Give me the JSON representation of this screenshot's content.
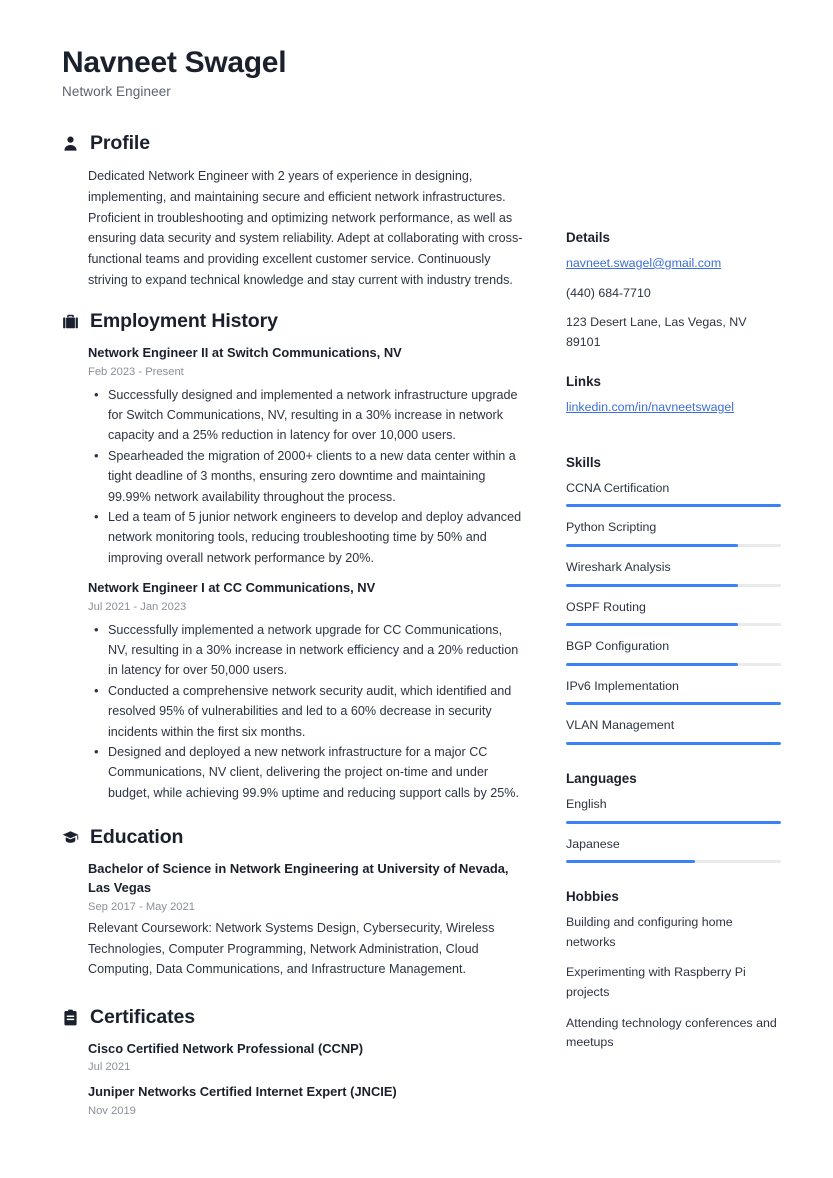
{
  "header": {
    "name": "Navneet Swagel",
    "job_title": "Network Engineer"
  },
  "accent_color": "#3b82f6",
  "link_color": "#3b6fd4",
  "profile": {
    "icon": "person-icon",
    "title": "Profile",
    "text": "Dedicated Network Engineer with 2 years of experience in designing, implementing, and maintaining secure and efficient network infrastructures. Proficient in troubleshooting and optimizing network performance, as well as ensuring data security and system reliability. Adept at collaborating with cross-functional teams and providing excellent customer service. Continuously striving to expand technical knowledge and stay current with industry trends."
  },
  "employment": {
    "icon": "briefcase-icon",
    "title": "Employment History",
    "entries": [
      {
        "title": "Network Engineer II at Switch Communications, NV",
        "date": "Feb 2023 - Present",
        "bullets": [
          "Successfully designed and implemented a network infrastructure upgrade for Switch Communications, NV, resulting in a 30% increase in network capacity and a 25% reduction in latency for over 10,000 users.",
          "Spearheaded the migration of 2000+ clients to a new data center within a tight deadline of 3 months, ensuring zero downtime and maintaining 99.99% network availability throughout the process.",
          "Led a team of 5 junior network engineers to develop and deploy advanced network monitoring tools, reducing troubleshooting time by 50% and improving overall network performance by 20%."
        ]
      },
      {
        "title": "Network Engineer I at CC Communications, NV",
        "date": "Jul 2021 - Jan 2023",
        "bullets": [
          "Successfully implemented a network upgrade for CC Communications, NV, resulting in a 30% increase in network efficiency and a 20% reduction in latency for over 50,000 users.",
          "Conducted a comprehensive network security audit, which identified and resolved 95% of vulnerabilities and led to a 60% decrease in security incidents within the first six months.",
          "Designed and deployed a new network infrastructure for a major CC Communications, NV client, delivering the project on-time and under budget, while achieving 99.9% uptime and reducing support calls by 25%."
        ]
      }
    ]
  },
  "education": {
    "icon": "graduation-cap-icon",
    "title": "Education",
    "entries": [
      {
        "title": "Bachelor of Science in Network Engineering at University of Nevada, Las Vegas",
        "date": "Sep 2017 - May 2021",
        "description": "Relevant Coursework: Network Systems Design, Cybersecurity, Wireless Technologies, Computer Programming, Network Administration, Cloud Computing, Data Communications, and Infrastructure Management."
      }
    ]
  },
  "certificates": {
    "icon": "clipboard-icon",
    "title": "Certificates",
    "entries": [
      {
        "title": "Cisco Certified Network Professional (CCNP)",
        "date": "Jul 2021"
      },
      {
        "title": "Juniper Networks Certified Internet Expert (JNCIE)",
        "date": "Nov 2019"
      }
    ]
  },
  "details": {
    "title": "Details",
    "email": "navneet.swagel@gmail.com",
    "phone": "(440) 684-7710",
    "address": "123 Desert Lane, Las Vegas, NV 89101"
  },
  "links": {
    "title": "Links",
    "items": [
      {
        "label": "linkedin.com/in/navneetswagel"
      }
    ]
  },
  "skills": {
    "title": "Skills",
    "items": [
      {
        "label": "CCNA Certification",
        "level": 100
      },
      {
        "label": "Python Scripting",
        "level": 80
      },
      {
        "label": "Wireshark Analysis",
        "level": 80
      },
      {
        "label": "OSPF Routing",
        "level": 80
      },
      {
        "label": "BGP Configuration",
        "level": 80
      },
      {
        "label": "IPv6 Implementation",
        "level": 100
      },
      {
        "label": "VLAN Management",
        "level": 100
      }
    ]
  },
  "languages": {
    "title": "Languages",
    "items": [
      {
        "label": "English",
        "level": 100
      },
      {
        "label": "Japanese",
        "level": 60
      }
    ]
  },
  "hobbies": {
    "title": "Hobbies",
    "items": [
      "Building and configuring home networks",
      "Experimenting with Raspberry Pi projects",
      "Attending technology conferences and meetups"
    ]
  }
}
